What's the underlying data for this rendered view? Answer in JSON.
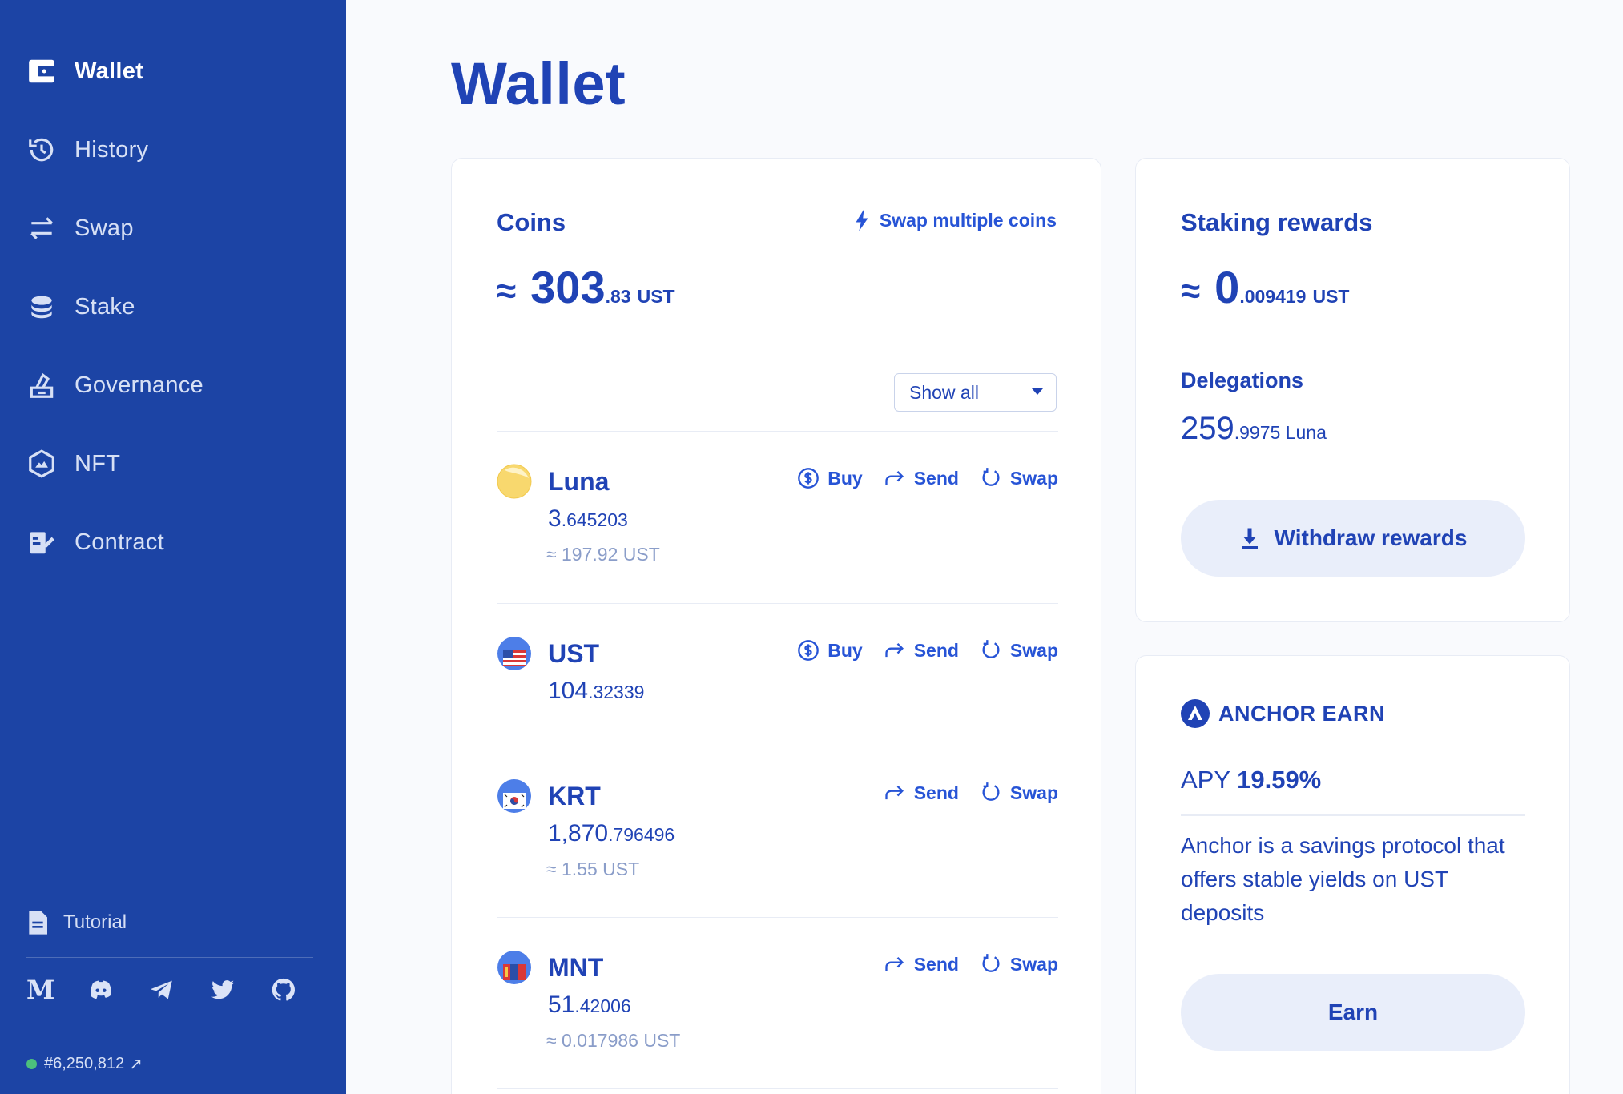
{
  "sidebar": {
    "items": [
      {
        "label": "Wallet",
        "icon": "wallet-icon",
        "active": true
      },
      {
        "label": "History",
        "icon": "history-icon"
      },
      {
        "label": "Swap",
        "icon": "swap-icon"
      },
      {
        "label": "Stake",
        "icon": "stake-icon"
      },
      {
        "label": "Governance",
        "icon": "governance-icon"
      },
      {
        "label": "NFT",
        "icon": "nft-icon"
      },
      {
        "label": "Contract",
        "icon": "contract-icon"
      }
    ],
    "tutorial_label": "Tutorial",
    "socials": [
      "medium-icon",
      "discord-icon",
      "telegram-icon",
      "twitter-icon",
      "github-icon"
    ],
    "medium_letter": "M",
    "block_height": "#6,250,812",
    "block_arrow": "↗"
  },
  "page": {
    "title": "Wallet"
  },
  "coins": {
    "title": "Coins",
    "swap_multiple_label": "Swap multiple coins",
    "total": {
      "approx": "≈",
      "integer": "303",
      "decimal": ".83",
      "unit": "UST"
    },
    "filter": {
      "selected": "Show all"
    },
    "actions": {
      "buy": "Buy",
      "send": "Send",
      "swap": "Swap"
    },
    "list": [
      {
        "name": "Luna",
        "amount_int": "3",
        "amount_dec": ".645203",
        "value": "≈ 197.92 UST"
      },
      {
        "name": "UST",
        "amount_int": "104",
        "amount_dec": ".32339",
        "value": ""
      },
      {
        "name": "KRT",
        "amount_int": "1,870",
        "amount_dec": ".796496",
        "value": "≈ 1.55 UST"
      },
      {
        "name": "MNT",
        "amount_int": "51",
        "amount_dec": ".42006",
        "value": "≈ 0.017986 UST"
      }
    ]
  },
  "staking": {
    "title": "Staking rewards",
    "total": {
      "approx": "≈",
      "integer": "0",
      "decimal": ".009419",
      "unit": "UST"
    },
    "delegations_title": "Delegations",
    "delegations_int": "259",
    "delegations_dec": ".9975 Luna",
    "withdraw_label": "Withdraw rewards"
  },
  "anchor": {
    "title": "ANCHOR EARN",
    "apy_label": "APY",
    "apy_value": "19.59%",
    "description": "Anchor is a savings protocol that offers stable yields on UST deposits",
    "earn_label": "Earn"
  },
  "colors": {
    "sidebar": "#1c44a5",
    "primary": "#2043b5",
    "accent": "#2754d6",
    "muted": "#8a9dc9",
    "online": "#4cc07c"
  }
}
